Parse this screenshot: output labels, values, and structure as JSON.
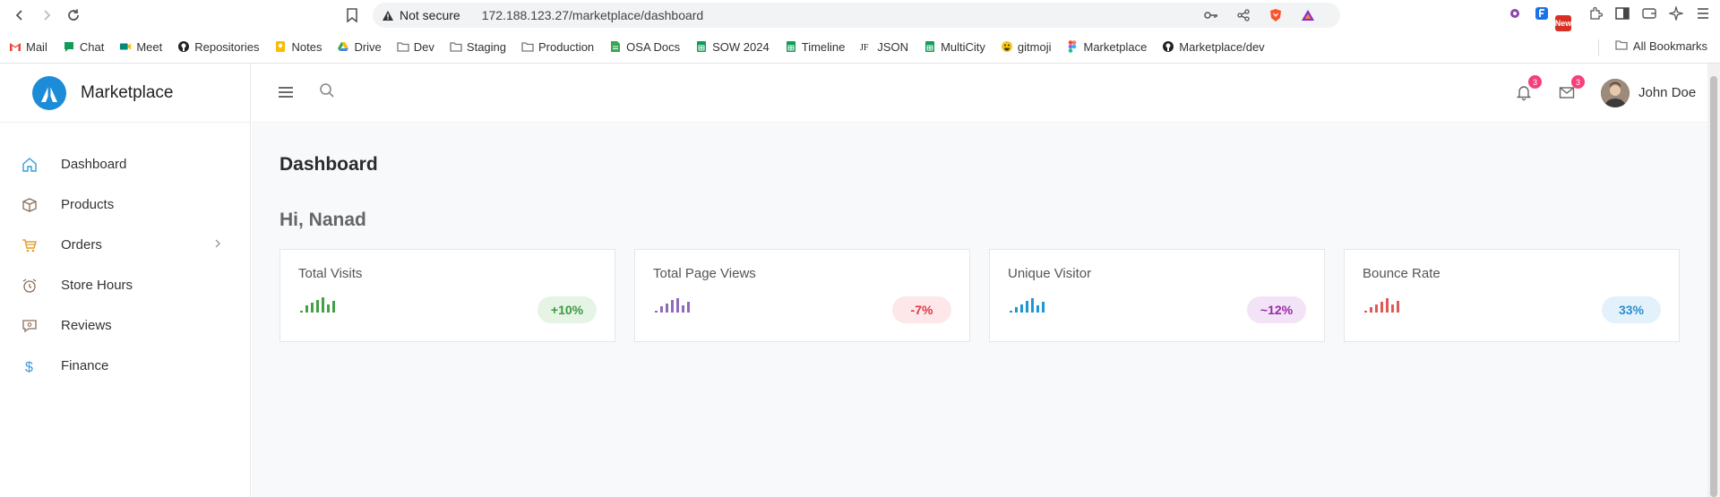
{
  "browser": {
    "address": {
      "warning": "Not secure",
      "url": "172.188.123.27/marketplace/dashboard"
    },
    "bookmarks": [
      {
        "label": "Mail",
        "icon": "gmail-icon",
        "color": "#ea4335"
      },
      {
        "label": "Chat",
        "icon": "chat-icon",
        "color": "#0f9d58"
      },
      {
        "label": "Meet",
        "icon": "meet-icon",
        "color": "#00897b"
      },
      {
        "label": "Repositories",
        "icon": "github-icon",
        "color": "#222222"
      },
      {
        "label": "Notes",
        "icon": "keep-icon",
        "color": "#fbbc04"
      },
      {
        "label": "Drive",
        "icon": "drive-icon",
        "color": "#34a853"
      },
      {
        "label": "Dev",
        "icon": "folder-icon",
        "color": "#777777"
      },
      {
        "label": "Staging",
        "icon": "folder-icon",
        "color": "#777777"
      },
      {
        "label": "Production",
        "icon": "folder-icon",
        "color": "#777777"
      },
      {
        "label": "OSA Docs",
        "icon": "docs-icon",
        "color": "#34a853"
      },
      {
        "label": "SOW 2024",
        "icon": "sheets-icon",
        "color": "#0f9d58"
      },
      {
        "label": "Timeline",
        "icon": "sheets-icon",
        "color": "#0f9d58"
      },
      {
        "label": "JSON",
        "icon": "json-icon",
        "color": "#222222"
      },
      {
        "label": "MultiCity",
        "icon": "sheets-icon",
        "color": "#0f9d58"
      },
      {
        "label": "gitmoji",
        "icon": "emoji-icon",
        "color": "#f5c518"
      },
      {
        "label": "Marketplace",
        "icon": "figma-icon",
        "color": "#f24e1e"
      },
      {
        "label": "Marketplace/dev",
        "icon": "github-icon",
        "color": "#222222"
      }
    ],
    "all_bookmarks": "All Bookmarks",
    "new_badge": "New"
  },
  "app": {
    "brand": "Marketplace",
    "sidebar": [
      {
        "label": "Dashboard",
        "icon": "home-icon",
        "color": "#3a9bd9"
      },
      {
        "label": "Products",
        "icon": "box-icon",
        "color": "#8a6d5a"
      },
      {
        "label": "Orders",
        "icon": "cart-icon",
        "color": "#e0a030"
      },
      {
        "label": "Store Hours",
        "icon": "alarm-clock-icon",
        "color": "#8a6d5a"
      },
      {
        "label": "Reviews",
        "icon": "review-icon",
        "color": "#8a6d5a"
      },
      {
        "label": "Finance",
        "icon": "dollar-icon",
        "color": "#3a9bd9"
      }
    ],
    "topbar": {
      "notifications": "3",
      "messages": "3",
      "user": "John Doe"
    },
    "page_title": "Dashboard",
    "greeting": "Hi, Nanad",
    "cards": [
      {
        "title": "Total Visits",
        "value": "+10%",
        "color": "#43a047",
        "pill_bg": "#e6f4e6",
        "pill_fg": "#3c9a40"
      },
      {
        "title": "Total Page Views",
        "value": "-7%",
        "color": "#8e6ab8",
        "pill_bg": "#fde7e9",
        "pill_fg": "#d93a45"
      },
      {
        "title": "Unique Visitor",
        "value": "~12%",
        "color": "#1e96d0",
        "pill_bg": "#f3e3f6",
        "pill_fg": "#9b2aa8"
      },
      {
        "title": "Bounce Rate",
        "value": "33%",
        "color": "#e05a55",
        "pill_bg": "#e3f1fb",
        "pill_fg": "#2a8fd0"
      }
    ]
  }
}
